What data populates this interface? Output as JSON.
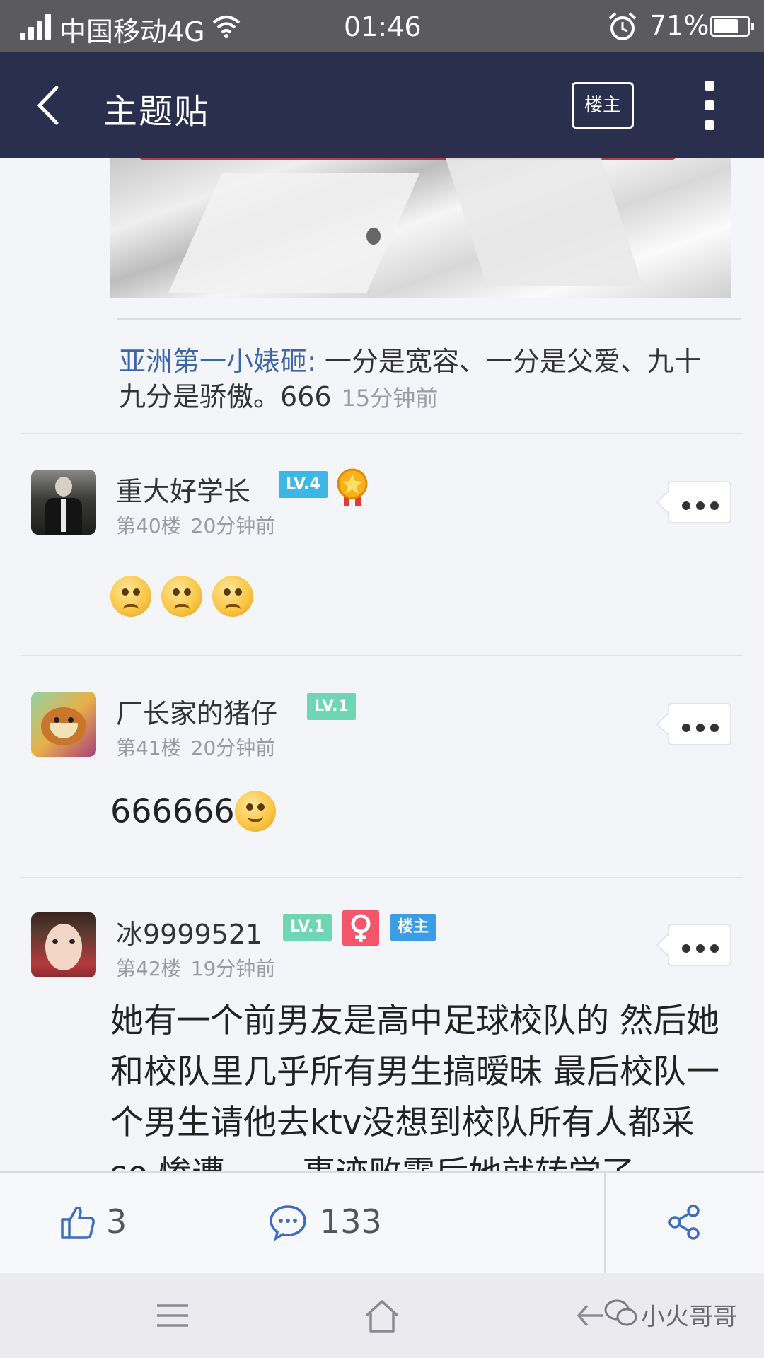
{
  "status_bar": {
    "carrier": "中国移动4G",
    "time": "01:46",
    "battery_text": "71%",
    "battery_level": 0.71
  },
  "nav": {
    "title": "主题贴",
    "louzhu_button": "楼主"
  },
  "quoted_reply": {
    "author": "亚洲第一小婊砸:",
    "text": " 一分是宽容、一分是父爱、九十九分是骄傲。666",
    "time": "15分钟前"
  },
  "floors": [
    {
      "username": "重大好学长",
      "level": "LV.4",
      "floor": "第40楼",
      "time": "20分钟前",
      "emoji_count": 3
    },
    {
      "username": "厂长家的猪仔",
      "level": "LV.1",
      "floor": "第41楼",
      "time": "20分钟前",
      "content": "666666"
    },
    {
      "username": "冰9999521",
      "level": "LV.1",
      "gender": "♀",
      "op_badge": "楼主",
      "floor": "第42楼",
      "time": "19分钟前",
      "content": "她有一个前男友是高中足球校队的 然后她和校队里几乎所有男生搞暧昧 最后校队一个男生请他去ktv没想到校队所有人都采 so 惨遭…… 事迹败露后她就转学了"
    }
  ],
  "action_bar": {
    "like_count": "3",
    "comment_count": "133"
  },
  "watermark": "小火哥哥"
}
